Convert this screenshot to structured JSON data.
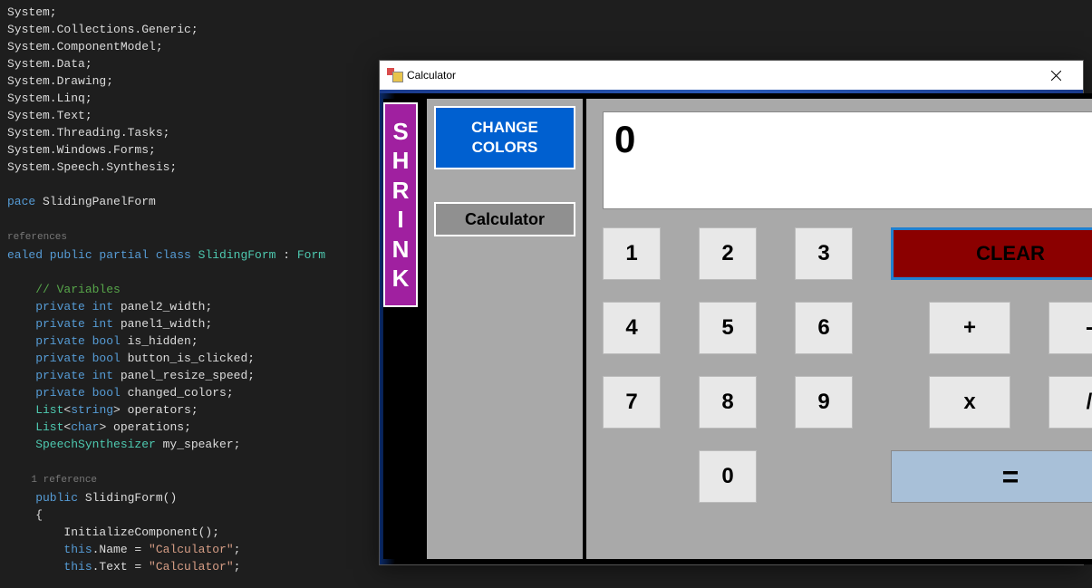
{
  "code": {
    "lines": [
      {
        "segments": [
          {
            "cls": "c-white",
            "text": "System;"
          }
        ]
      },
      {
        "segments": [
          {
            "cls": "c-white",
            "text": "System.Collections.Generic;"
          }
        ]
      },
      {
        "segments": [
          {
            "cls": "c-white",
            "text": "System.ComponentModel;"
          }
        ]
      },
      {
        "segments": [
          {
            "cls": "c-white",
            "text": "System.Data;"
          }
        ]
      },
      {
        "segments": [
          {
            "cls": "c-white",
            "text": "System.Drawing;"
          }
        ]
      },
      {
        "segments": [
          {
            "cls": "c-white",
            "text": "System.Linq;"
          }
        ]
      },
      {
        "segments": [
          {
            "cls": "c-white",
            "text": "System.Text;"
          }
        ]
      },
      {
        "segments": [
          {
            "cls": "c-white",
            "text": "System.Threading.Tasks;"
          }
        ]
      },
      {
        "segments": [
          {
            "cls": "c-white",
            "text": "System.Windows.Forms;"
          }
        ]
      },
      {
        "segments": [
          {
            "cls": "c-white",
            "text": "System.Speech.Synthesis;"
          }
        ]
      },
      {
        "segments": [
          {
            "cls": "c-white",
            "text": " "
          }
        ]
      },
      {
        "segments": [
          {
            "cls": "c-blue",
            "text": "pace "
          },
          {
            "cls": "c-white",
            "text": "SlidingPanelForm"
          }
        ]
      },
      {
        "segments": [
          {
            "cls": "c-white",
            "text": " "
          }
        ]
      },
      {
        "segments": [
          {
            "cls": "c-ref",
            "text": "references"
          }
        ]
      },
      {
        "segments": [
          {
            "cls": "c-blue",
            "text": "ealed public partial class "
          },
          {
            "cls": "c-teal",
            "text": "SlidingForm"
          },
          {
            "cls": "c-white",
            "text": " : "
          },
          {
            "cls": "c-teal",
            "text": "Form"
          }
        ]
      },
      {
        "segments": [
          {
            "cls": "c-white",
            "text": " "
          }
        ]
      },
      {
        "segments": [
          {
            "cls": "c-comment",
            "text": "    // Variables"
          }
        ]
      },
      {
        "segments": [
          {
            "cls": "c-blue",
            "text": "    private int "
          },
          {
            "cls": "c-white",
            "text": "panel2_width;"
          }
        ]
      },
      {
        "segments": [
          {
            "cls": "c-blue",
            "text": "    private int "
          },
          {
            "cls": "c-white",
            "text": "panel1_width;"
          }
        ]
      },
      {
        "segments": [
          {
            "cls": "c-blue",
            "text": "    private bool "
          },
          {
            "cls": "c-white",
            "text": "is_hidden;"
          }
        ]
      },
      {
        "segments": [
          {
            "cls": "c-blue",
            "text": "    private bool "
          },
          {
            "cls": "c-white",
            "text": "button_is_clicked;"
          }
        ]
      },
      {
        "segments": [
          {
            "cls": "c-blue",
            "text": "    private int "
          },
          {
            "cls": "c-white",
            "text": "panel_resize_speed;"
          }
        ]
      },
      {
        "segments": [
          {
            "cls": "c-blue",
            "text": "    private bool "
          },
          {
            "cls": "c-white",
            "text": "changed_colors;"
          }
        ]
      },
      {
        "segments": [
          {
            "cls": "c-teal",
            "text": "    List"
          },
          {
            "cls": "c-white",
            "text": "<"
          },
          {
            "cls": "c-blue",
            "text": "string"
          },
          {
            "cls": "c-white",
            "text": "> operators;"
          }
        ]
      },
      {
        "segments": [
          {
            "cls": "c-teal",
            "text": "    List"
          },
          {
            "cls": "c-white",
            "text": "<"
          },
          {
            "cls": "c-blue",
            "text": "char"
          },
          {
            "cls": "c-white",
            "text": "> operations;"
          }
        ]
      },
      {
        "segments": [
          {
            "cls": "c-teal",
            "text": "    SpeechSynthesizer"
          },
          {
            "cls": "c-white",
            "text": " my_speaker;"
          }
        ]
      },
      {
        "segments": [
          {
            "cls": "c-white",
            "text": " "
          }
        ]
      },
      {
        "segments": [
          {
            "cls": "c-ref",
            "text": "    1 reference"
          }
        ]
      },
      {
        "segments": [
          {
            "cls": "c-blue",
            "text": "    public "
          },
          {
            "cls": "c-white",
            "text": "SlidingForm()"
          }
        ]
      },
      {
        "segments": [
          {
            "cls": "c-white",
            "text": "    {"
          }
        ]
      },
      {
        "segments": [
          {
            "cls": "c-white",
            "text": "        InitializeComponent();"
          }
        ]
      },
      {
        "segments": [
          {
            "cls": "c-blue",
            "text": "        this"
          },
          {
            "cls": "c-white",
            "text": ".Name = "
          },
          {
            "cls": "c-orange",
            "text": "\"Calculator\""
          },
          {
            "cls": "c-white",
            "text": ";"
          }
        ]
      },
      {
        "segments": [
          {
            "cls": "c-blue",
            "text": "        this"
          },
          {
            "cls": "c-white",
            "text": ".Text = "
          },
          {
            "cls": "c-orange",
            "text": "\"Calculator\""
          },
          {
            "cls": "c-white",
            "text": ";"
          }
        ]
      }
    ]
  },
  "window": {
    "title": "Calculator"
  },
  "calc": {
    "shrink": [
      "S",
      "H",
      "R",
      "I",
      "N",
      "K"
    ],
    "change_colors_l1": "CHANGE",
    "change_colors_l2": "COLORS",
    "calculator_label": "Calculator",
    "display_value": "0",
    "clear_label": "CLEAR",
    "equals_label": "=",
    "digits": {
      "n1": "1",
      "n2": "2",
      "n3": "3",
      "n4": "4",
      "n5": "5",
      "n6": "6",
      "n7": "7",
      "n8": "8",
      "n9": "9",
      "n0": "0"
    },
    "ops": {
      "plus": "+",
      "minus": "-",
      "mult": "x",
      "div": "/"
    }
  }
}
